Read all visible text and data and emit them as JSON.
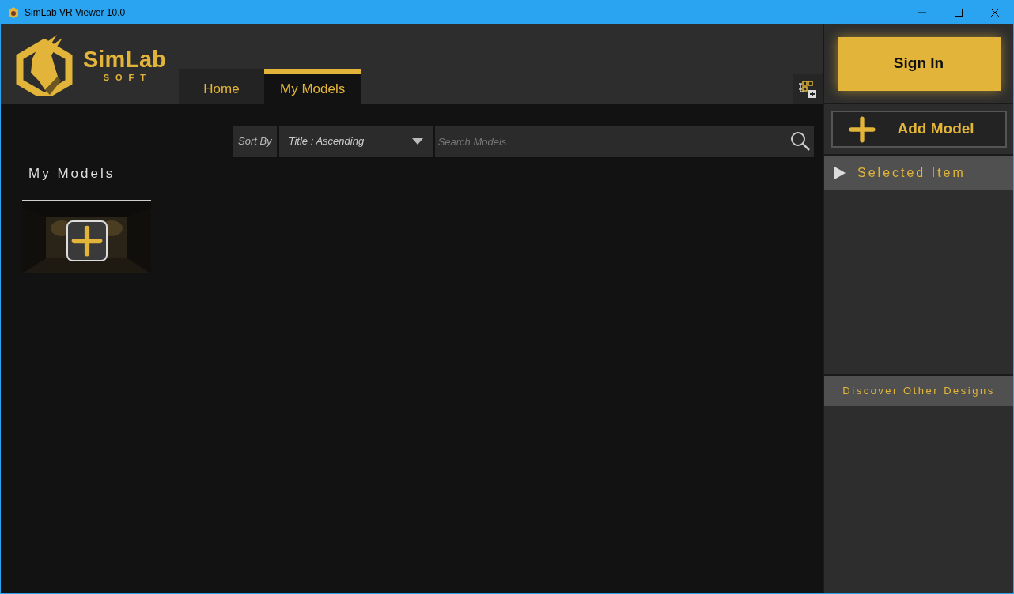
{
  "window": {
    "title": "SimLab VR Viewer 10.0"
  },
  "logo": {
    "name": "SimLab",
    "tagline": "SOFT"
  },
  "tabs": [
    {
      "label": "Home",
      "selected": false
    },
    {
      "label": "My Models",
      "selected": true
    }
  ],
  "toolbar": {
    "sort_label": "Sort By",
    "sort_value": "Title : Ascending",
    "search": {
      "placeholder": "Search Models"
    }
  },
  "section_title": "My Models",
  "models": [
    {
      "kind": "add"
    }
  ],
  "sidebar": {
    "sign_in": "Sign In",
    "add_model": "Add Model",
    "selected_item": {
      "label": "Selected Item",
      "expanded": false
    },
    "discover": "Discover Other Designs"
  }
}
